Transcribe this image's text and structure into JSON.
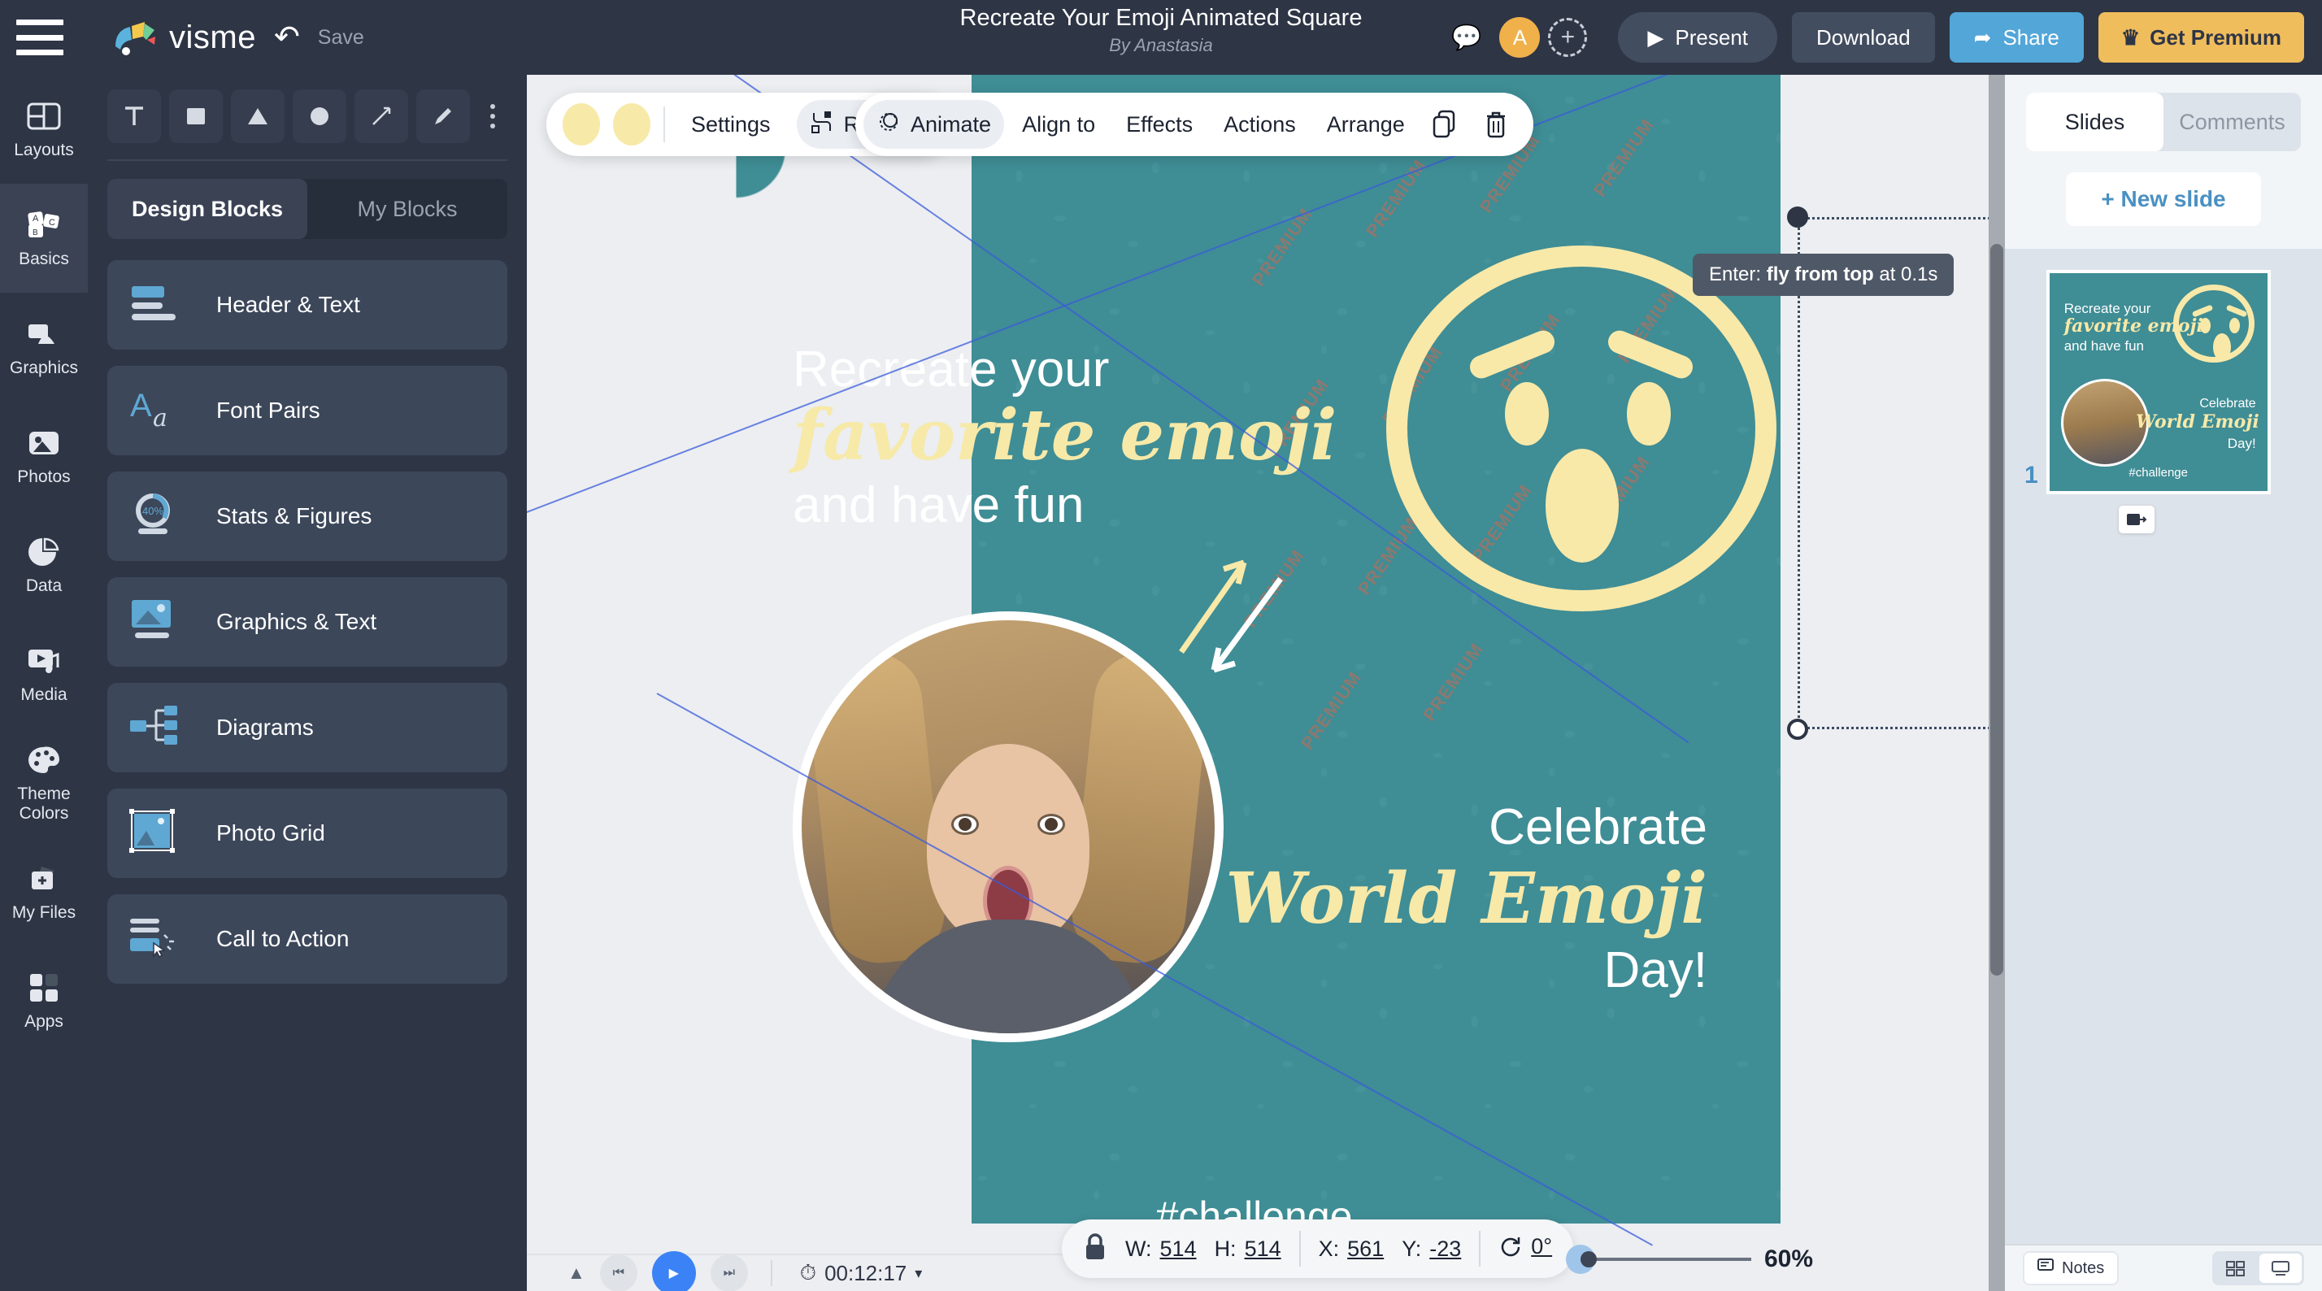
{
  "header": {
    "menu_icon": "hamburger-menu-icon",
    "brand": "visme",
    "undo_icon": "undo-icon",
    "save_label": "Save",
    "doc_title": "Recreate Your Emoji Animated Square",
    "doc_author": "By Anastasia",
    "comment_icon": "comment-icon",
    "avatar_initial": "A",
    "add_collaborator_icon": "add-user-icon",
    "present_label": "Present",
    "download_label": "Download",
    "share_label": "Share",
    "premium_label": "Get Premium"
  },
  "rail": {
    "items": [
      {
        "label": "Layouts",
        "icon": "layouts-icon",
        "active": false
      },
      {
        "label": "Basics",
        "icon": "basics-icon",
        "active": true
      },
      {
        "label": "Graphics",
        "icon": "graphics-icon",
        "active": false
      },
      {
        "label": "Photos",
        "icon": "photos-icon",
        "active": false
      },
      {
        "label": "Data",
        "icon": "data-icon",
        "active": false
      },
      {
        "label": "Media",
        "icon": "media-icon",
        "active": false
      },
      {
        "label": "Theme Colors",
        "icon": "theme-colors-icon",
        "active": false
      },
      {
        "label": "My Files",
        "icon": "my-files-icon",
        "active": false
      },
      {
        "label": "Apps",
        "icon": "apps-icon",
        "active": false
      }
    ]
  },
  "panel": {
    "tools": [
      {
        "name": "text-tool",
        "glyph": "T"
      },
      {
        "name": "rectangle-tool",
        "glyph": "square"
      },
      {
        "name": "triangle-tool",
        "glyph": "triangle"
      },
      {
        "name": "circle-tool",
        "glyph": "circle"
      },
      {
        "name": "line-tool",
        "glyph": "arrow"
      },
      {
        "name": "pen-tool",
        "glyph": "pen"
      },
      {
        "name": "more-tools",
        "glyph": "kebab"
      }
    ],
    "tabs": [
      {
        "label": "Design Blocks",
        "active": true
      },
      {
        "label": "My Blocks",
        "active": false
      }
    ],
    "blocks": [
      {
        "label": "Header & Text",
        "icon": "header-text-icon"
      },
      {
        "label": "Font Pairs",
        "icon": "font-pairs-icon"
      },
      {
        "label": "Stats & Figures",
        "icon": "stats-figures-icon",
        "badge": "40%"
      },
      {
        "label": "Graphics & Text",
        "icon": "graphics-text-icon"
      },
      {
        "label": "Diagrams",
        "icon": "diagrams-icon"
      },
      {
        "label": "Photo Grid",
        "icon": "photo-grid-icon"
      },
      {
        "label": "Call to Action",
        "icon": "call-to-action-icon"
      }
    ]
  },
  "object_toolbar": {
    "settings_label": "Settings",
    "replace_label": "Replace",
    "replace_icon": "replace-icon",
    "swatch_colors": [
      "#f7e9a8",
      "#f7e9a8"
    ]
  },
  "context_toolbar": {
    "items": [
      {
        "label": "Animate",
        "icon": "animate-icon",
        "active": true
      },
      {
        "label": "Align to",
        "icon": "align-icon",
        "active": false
      },
      {
        "label": "Effects",
        "icon": "effects-icon",
        "active": false
      },
      {
        "label": "Actions",
        "icon": "actions-icon",
        "active": false
      },
      {
        "label": "Arrange",
        "icon": "arrange-icon",
        "active": false
      }
    ],
    "duplicate_icon": "duplicate-icon",
    "delete_icon": "trash-icon"
  },
  "animation_tooltip": {
    "prefix": "Enter: ",
    "effect": "fly from top",
    "suffix": " at 0.1s",
    "full": "Enter: fly from top at 0.1s"
  },
  "canvas": {
    "background_color": "#3f8d95",
    "accent_color": "#f7e9a8",
    "headline_line1": "Recreate your",
    "headline_line2": "favorite emoji",
    "headline_line3": "and have fun",
    "celebrate_line1": "Celebrate",
    "celebrate_line2": "World Emoji",
    "celebrate_line3": "Day!",
    "hashtag": "#challenge",
    "watermark_text": "PREMIUM"
  },
  "playback": {
    "prev_icon": "skip-previous-icon",
    "play_icon": "play-icon",
    "next_icon": "skip-next-icon",
    "clock_icon": "clock-icon",
    "timestamp": "00:12:17",
    "chevron_icon": "chevron-down-icon"
  },
  "statusbar": {
    "lock_icon": "lock-icon",
    "w_label": "W:",
    "w_value": "514",
    "h_label": "H:",
    "h_value": "514",
    "x_label": "X:",
    "x_value": "561",
    "y_label": "Y:",
    "y_value": "-23",
    "rotate_icon": "rotate-icon",
    "rotation": "0°",
    "zoom_percent": "60%"
  },
  "help": {
    "label": "?"
  },
  "right_panel": {
    "tabs": [
      {
        "label": "Slides",
        "active": true
      },
      {
        "label": "Comments",
        "active": false
      }
    ],
    "new_slide_label": "+ New slide",
    "slides": [
      {
        "number": "1",
        "headline_line1": "Recreate your",
        "headline_line2": "favorite emoji",
        "headline_line3": "and have fun",
        "celebrate_line1": "Celebrate",
        "celebrate_line2": "World Emoji",
        "celebrate_line3": "Day!",
        "hashtag": "#challenge"
      }
    ],
    "transition_icon": "transition-icon",
    "notes_label": "Notes",
    "notes_icon": "notes-icon",
    "view_grid_icon": "grid-view-icon",
    "view_single_icon": "single-view-icon"
  }
}
